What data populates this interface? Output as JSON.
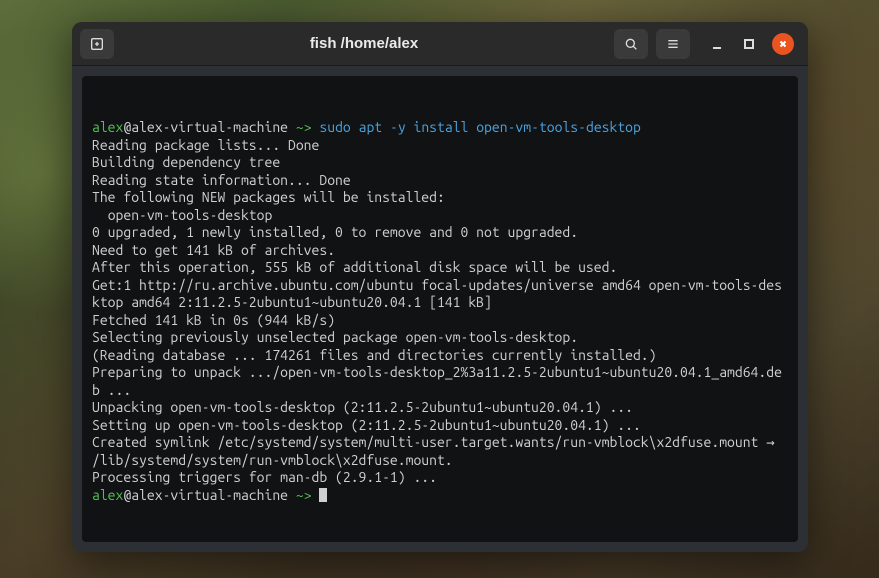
{
  "window": {
    "title": "fish /home/alex"
  },
  "prompt": {
    "user": "alex",
    "sep": "@",
    "host": "alex-virtual-machine",
    "path": " ~> ",
    "sudo": "sudo",
    "command": " apt -y install open-vm-tools-desktop"
  },
  "output": [
    "Reading package lists... Done",
    "Building dependency tree",
    "Reading state information... Done",
    "The following NEW packages will be installed:",
    "  open-vm-tools-desktop",
    "0 upgraded, 1 newly installed, 0 to remove and 0 not upgraded.",
    "Need to get 141 kB of archives.",
    "After this operation, 555 kB of additional disk space will be used.",
    "Get:1 http://ru.archive.ubuntu.com/ubuntu focal-updates/universe amd64 open-vm-tools-desktop amd64 2:11.2.5-2ubuntu1~ubuntu20.04.1 [141 kB]",
    "Fetched 141 kB in 0s (944 kB/s)",
    "Selecting previously unselected package open-vm-tools-desktop.",
    "(Reading database ... 174261 files and directories currently installed.)",
    "Preparing to unpack .../open-vm-tools-desktop_2%3a11.2.5-2ubuntu1~ubuntu20.04.1_amd64.deb ...",
    "Unpacking open-vm-tools-desktop (2:11.2.5-2ubuntu1~ubuntu20.04.1) ...",
    "Setting up open-vm-tools-desktop (2:11.2.5-2ubuntu1~ubuntu20.04.1) ...",
    "Created symlink /etc/systemd/system/multi-user.target.wants/run-vmblock\\x2dfuse.mount → /lib/systemd/system/run-vmblock\\x2dfuse.mount.",
    "Processing triggers for man-db (2.9.1-1) ..."
  ],
  "prompt2": {
    "user": "alex",
    "sep": "@",
    "host": "alex-virtual-machine",
    "path": " ~> "
  }
}
